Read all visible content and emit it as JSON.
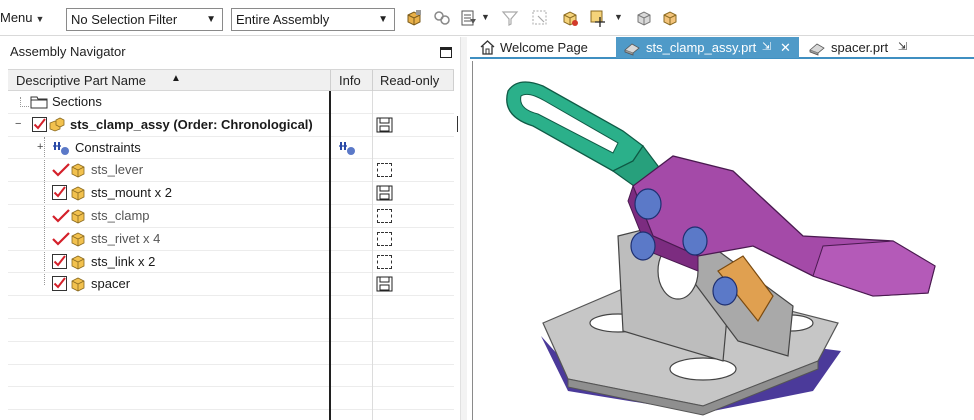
{
  "toolbar": {
    "menu_label": "Menu",
    "selection_filter": "No Selection Filter",
    "scope": "Entire Assembly"
  },
  "navigator": {
    "title": "Assembly Navigator",
    "columns": {
      "name": "Descriptive Part Name",
      "info": "Info",
      "readonly": "Read-only"
    },
    "rows": [
      {
        "label": "Sections"
      },
      {
        "label": "sts_clamp_assy (Order: Chronological)"
      },
      {
        "label": "Constraints"
      },
      {
        "label": "sts_lever"
      },
      {
        "label": "sts_mount x 2"
      },
      {
        "label": "sts_clamp"
      },
      {
        "label": "sts_rivet x 4"
      },
      {
        "label": "sts_link x 2"
      },
      {
        "label": "spacer"
      }
    ]
  },
  "tabs": {
    "welcome": "Welcome Page",
    "assy": "sts_clamp_assy.prt",
    "spacer": "spacer.prt"
  },
  "colors": {
    "accent": "#4f9ac8",
    "lever": "#2bb08a",
    "arm": "#a44aa8",
    "base": "#b8b8b8",
    "pin": "#5b79c8",
    "link": "#e0a050",
    "check": "#d4202a"
  }
}
